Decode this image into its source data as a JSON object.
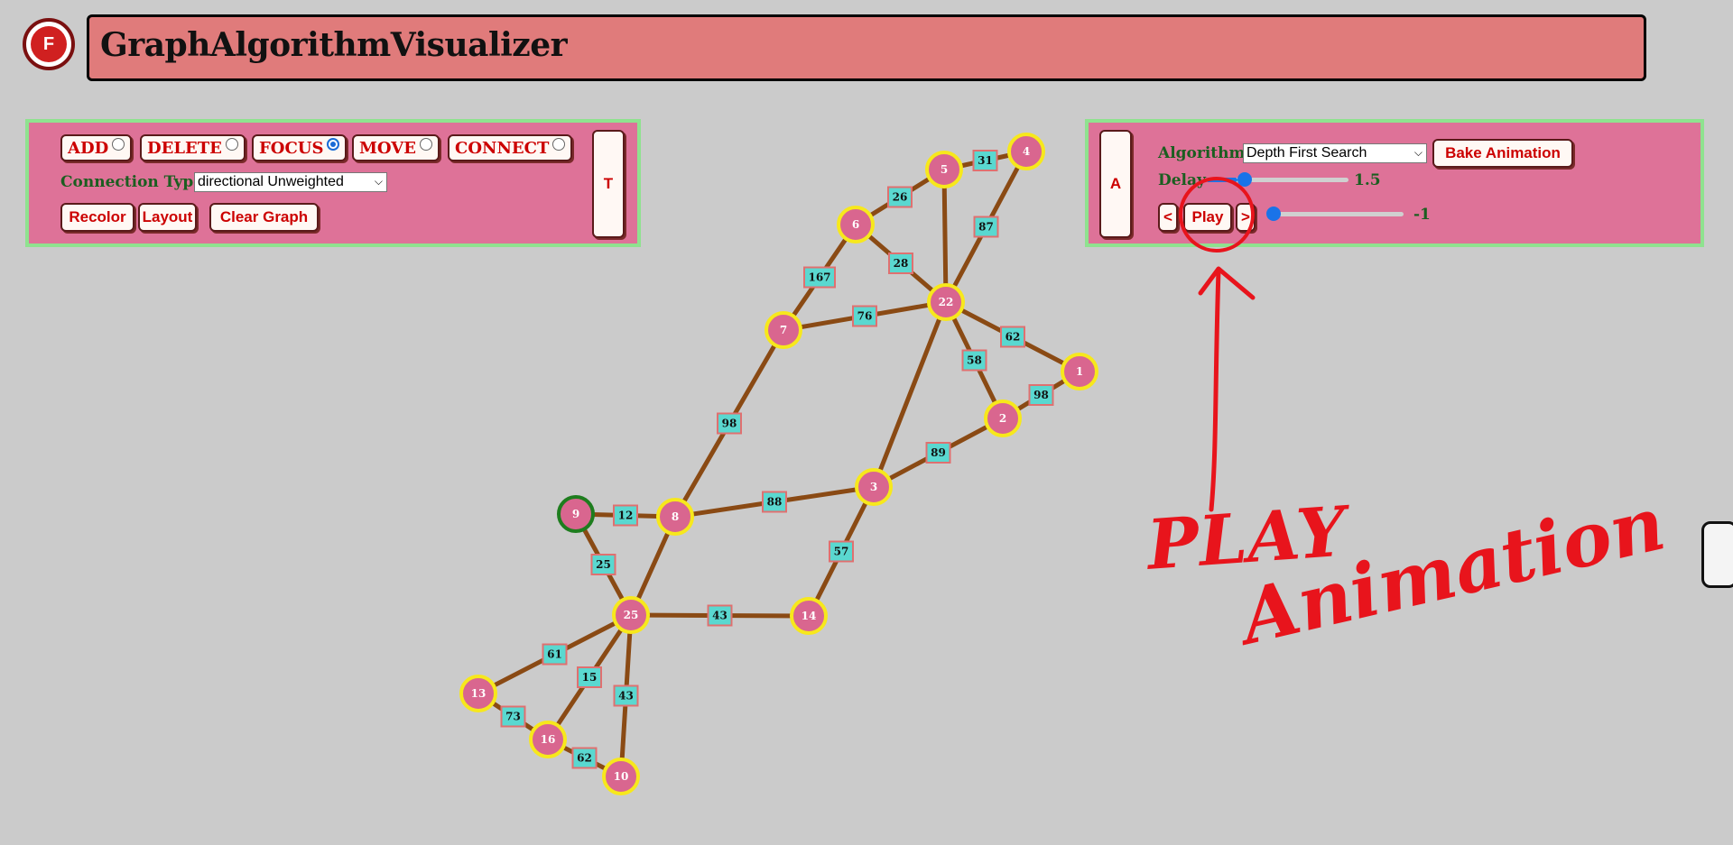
{
  "app": {
    "logo_letter": "F",
    "title": "GraphAlgorithmVisualizer"
  },
  "tools": {
    "modes": [
      {
        "label": "ADD",
        "selected": false
      },
      {
        "label": "DELETE",
        "selected": false
      },
      {
        "label": "FOCUS",
        "selected": true
      },
      {
        "label": "MOVE",
        "selected": false
      },
      {
        "label": "CONNECT",
        "selected": false
      }
    ],
    "connection_type_label": "Connection Type",
    "connection_type_value": "directional Unweighted",
    "recolor_label": "Recolor",
    "layout_label": "Layout",
    "clear_label": "Clear Graph",
    "side_button_label": "T"
  },
  "algo": {
    "side_button_label": "A",
    "algorithm_label": "Algorithm",
    "algorithm_value": "Depth First Search",
    "bake_label": "Bake Animation",
    "delay_label": "Delay",
    "delay_value": "1.5",
    "delay_fraction": 0.22,
    "prev_label": "<",
    "play_label": "Play",
    "next_label": ">",
    "step_value": "-1",
    "step_fraction": 0.0
  },
  "annotation": {
    "word1": "PLAY",
    "word2": "Animation",
    "color": "#e8141c"
  },
  "colors": {
    "node_fill": "#d9668f",
    "node_ring": "#f7e81c",
    "focus_ring": "#1e7d1e",
    "edge": "#8a4a14",
    "label_fill": "#5ad8d0",
    "label_border": "#e07070"
  },
  "graph": {
    "nodes": [
      {
        "id": "9",
        "focus": true
      },
      {
        "id": "8"
      },
      {
        "id": "25"
      },
      {
        "id": "13"
      },
      {
        "id": "16"
      },
      {
        "id": "10"
      },
      {
        "id": "14"
      },
      {
        "id": "3"
      },
      {
        "id": "7"
      },
      {
        "id": "6"
      },
      {
        "id": "5"
      },
      {
        "id": "4"
      },
      {
        "id": "22"
      },
      {
        "id": "1"
      },
      {
        "id": "2"
      }
    ],
    "edges": [
      {
        "a": "9",
        "b": "8",
        "w": "12"
      },
      {
        "a": "9",
        "b": "25",
        "w": "25"
      },
      {
        "a": "8",
        "b": "7",
        "w": "98"
      },
      {
        "a": "8",
        "b": "3",
        "w": "88"
      },
      {
        "a": "8",
        "b": "25",
        "w": ""
      },
      {
        "a": "25",
        "b": "14",
        "w": "43"
      },
      {
        "a": "25",
        "b": "13",
        "w": "61"
      },
      {
        "a": "25",
        "b": "16",
        "w": "15"
      },
      {
        "a": "25",
        "b": "10",
        "w": "43"
      },
      {
        "a": "13",
        "b": "16",
        "w": "73"
      },
      {
        "a": "16",
        "b": "10",
        "w": "62"
      },
      {
        "a": "14",
        "b": "3",
        "w": "57"
      },
      {
        "a": "3",
        "b": "2",
        "w": "89"
      },
      {
        "a": "3",
        "b": "22",
        "w": ""
      },
      {
        "a": "7",
        "b": "6",
        "w": "167"
      },
      {
        "a": "7",
        "b": "22",
        "w": "76"
      },
      {
        "a": "6",
        "b": "5",
        "w": "26"
      },
      {
        "a": "6",
        "b": "22",
        "w": "28"
      },
      {
        "a": "5",
        "b": "4",
        "w": "31"
      },
      {
        "a": "5",
        "b": "22",
        "w": ""
      },
      {
        "a": "4",
        "b": "22",
        "w": "87"
      },
      {
        "a": "22",
        "b": "1",
        "w": "62"
      },
      {
        "a": "22",
        "b": "2",
        "w": "58"
      },
      {
        "a": "2",
        "b": "1",
        "w": "98"
      }
    ]
  }
}
